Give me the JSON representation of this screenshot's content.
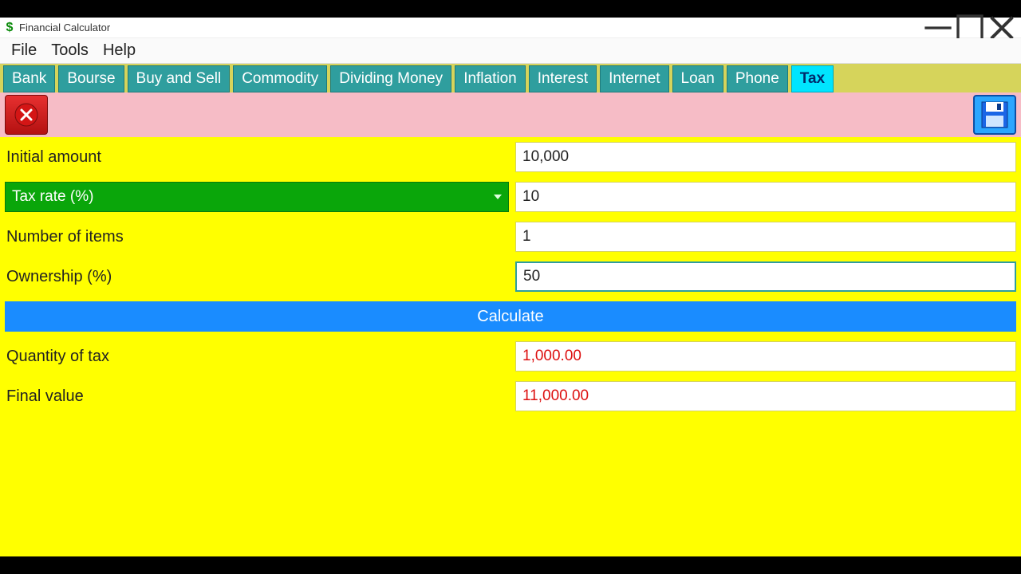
{
  "window": {
    "title": "Financial Calculator"
  },
  "menu": {
    "file": "File",
    "tools": "Tools",
    "help": "Help"
  },
  "tabs": [
    {
      "label": "Bank",
      "active": false
    },
    {
      "label": "Bourse",
      "active": false
    },
    {
      "label": "Buy and Sell",
      "active": false
    },
    {
      "label": "Commodity",
      "active": false
    },
    {
      "label": "Dividing Money",
      "active": false
    },
    {
      "label": "Inflation",
      "active": false
    },
    {
      "label": "Interest",
      "active": false
    },
    {
      "label": "Internet",
      "active": false
    },
    {
      "label": "Loan",
      "active": false
    },
    {
      "label": "Phone",
      "active": false
    },
    {
      "label": "Tax",
      "active": true
    }
  ],
  "form": {
    "initial_amount_label": "Initial amount",
    "initial_amount_value": "10,000",
    "tax_rate_label": "Tax rate (%)",
    "tax_rate_value": "10",
    "num_items_label": "Number of items",
    "num_items_value": "1",
    "ownership_label": "Ownership (%)",
    "ownership_value": "50",
    "calculate_label": "Calculate",
    "qty_tax_label": "Quantity of tax",
    "qty_tax_value": "1,000.00",
    "final_value_label": "Final value",
    "final_value_value": "11,000.00"
  }
}
